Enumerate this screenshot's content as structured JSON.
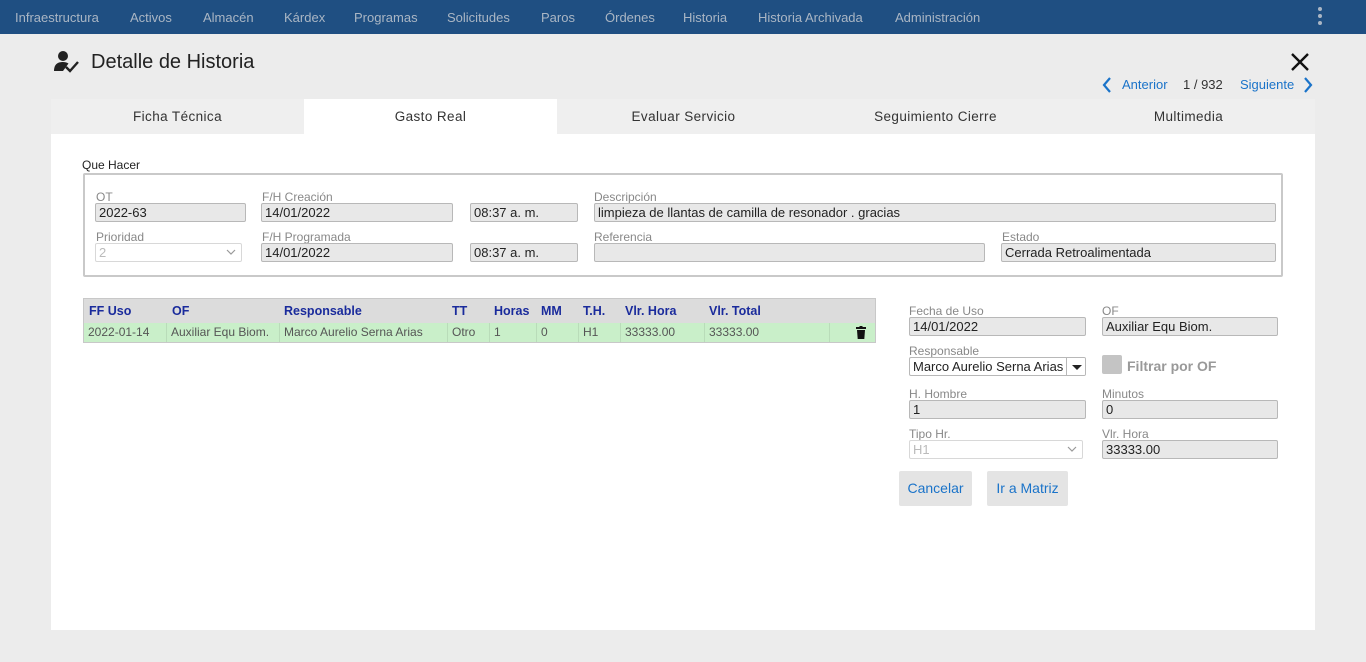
{
  "nav": {
    "items": [
      "Infraestructura",
      "Activos",
      "Almacén",
      "Kárdex",
      "Programas",
      "Solicitudes",
      "Paros",
      "Órdenes",
      "Historia",
      "Historia Archivada",
      "Administración"
    ]
  },
  "header": {
    "title": "Detalle de Historia",
    "pager": {
      "prev": "Anterior",
      "count": "1 / 932",
      "next": "Siguiente"
    }
  },
  "tabs": [
    "Ficha Técnica",
    "Gasto Real",
    "Evaluar Servicio",
    "Seguimiento Cierre",
    "Multimedia"
  ],
  "active_tab": "Gasto Real",
  "que_hacer": {
    "title": "Que Hacer",
    "ot": {
      "label": "OT",
      "value": "2022-63"
    },
    "fh_creacion": {
      "label": "F/H Creación",
      "date": "14/01/2022",
      "time": "08:37 a. m."
    },
    "descripcion": {
      "label": "Descripción",
      "value": "limpieza de llantas de camilla de resonador . gracias"
    },
    "prioridad": {
      "label": "Prioridad",
      "value": "2"
    },
    "fh_programada": {
      "label": "F/H Programada",
      "date": "14/01/2022",
      "time": "08:37 a. m."
    },
    "referencia": {
      "label": "Referencia",
      "value": ""
    },
    "estado": {
      "label": "Estado",
      "value": "Cerrada Retroalimentada"
    }
  },
  "table": {
    "headers": [
      "FF Uso",
      "OF",
      "Responsable",
      "TT",
      "Horas",
      "MM",
      "T.H.",
      "Vlr. Hora",
      "Vlr. Total"
    ],
    "rows": [
      [
        "2022-01-14",
        "Auxiliar Equ Biom.",
        "Marco Aurelio Serna Arias",
        "Otro",
        "1",
        "0",
        "H1",
        "33333.00",
        "33333.00"
      ]
    ]
  },
  "detail": {
    "fecha_uso": {
      "label": "Fecha de Uso",
      "value": "14/01/2022"
    },
    "of": {
      "label": "OF",
      "value": "Auxiliar Equ Biom."
    },
    "responsable": {
      "label": "Responsable",
      "value": "Marco Aurelio Serna Arias"
    },
    "filtrar_of": "Filtrar por OF",
    "h_hombre": {
      "label": "H. Hombre",
      "value": "1"
    },
    "minutos": {
      "label": "Minutos",
      "value": "0"
    },
    "tipo_hr": {
      "label": "Tipo Hr.",
      "value": "H1"
    },
    "vlr_hora": {
      "label": "Vlr. Hora",
      "value": "33333.00"
    },
    "cancel_label": "Cancelar",
    "matrix_label": "Ir a Matriz"
  },
  "colors": {
    "nav_bg": "#1f4f82",
    "accent": "#1a73c9",
    "row_selected": "#c9efc9",
    "header_text": "#1a2b9c"
  }
}
